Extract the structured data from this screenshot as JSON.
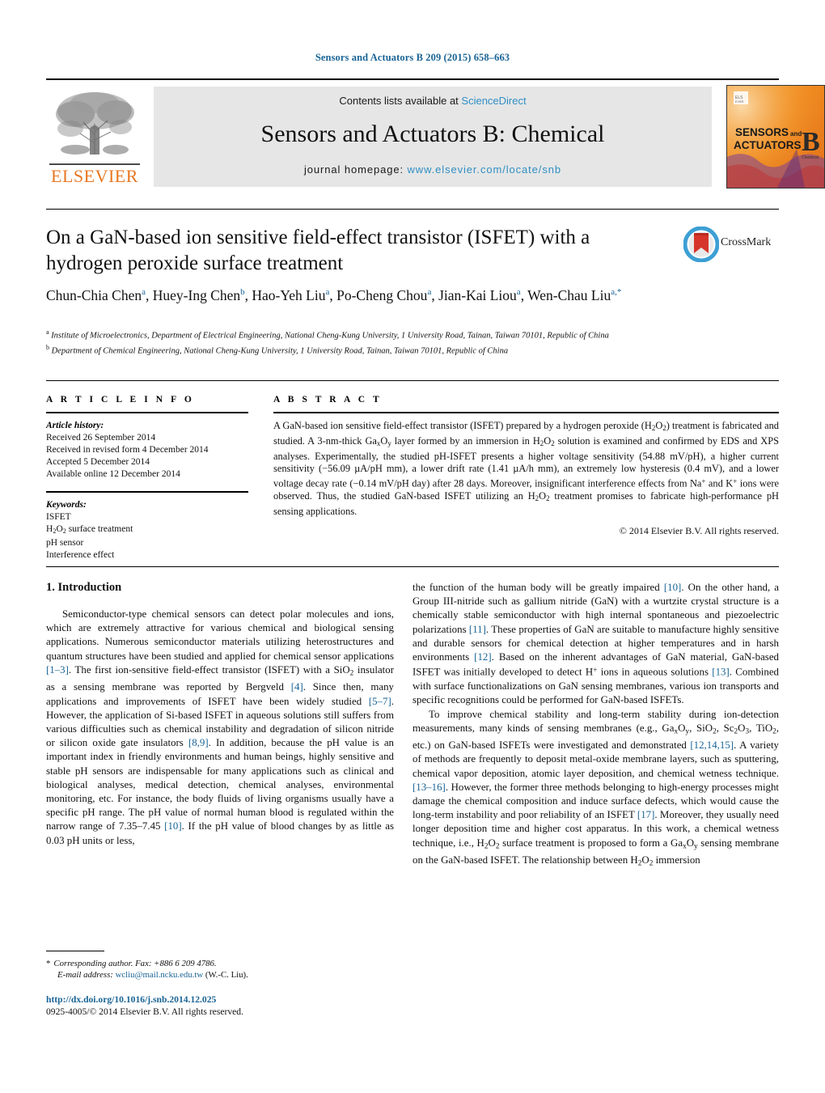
{
  "running_head": "Sensors and Actuators B 209 (2015) 658–663",
  "banner": {
    "contents_prefix": "Contents lists available at ",
    "sciencedirect": "ScienceDirect",
    "journal_title": "Sensors and Actuators B: Chemical",
    "homepage_prefix": "journal homepage: ",
    "homepage_url": "www.elsevier.com/locate/snb",
    "publisher": "ELSEVIER",
    "cover": {
      "line1": "SENSORS",
      "line1_small": "and",
      "line2": "ACTUATORS",
      "letter": "B",
      "letter_sub": "Chemical"
    }
  },
  "article": {
    "title": "On a GaN-based ion sensitive field-effect transistor (ISFET) with a hydrogen peroxide surface treatment",
    "authors_html": "Chun-Chia Chen<sup>a</sup>, Huey-Ing Chen<sup>b</sup>, Hao-Yeh Liu<sup>a</sup>, Po-Cheng Chou<sup>a</sup>, Jian-Kai Liou<sup>a</sup>, Wen-Chau Liu<sup>a,*</sup>",
    "affiliation_a": "Institute of Microelectronics, Department of Electrical Engineering, National Cheng-Kung University, 1 University Road, Tainan, Taiwan 70101, Republic of China",
    "affiliation_b": "Department of Chemical Engineering, National Cheng-Kung University, 1 University Road, Tainan, Taiwan 70101, Republic of China",
    "crossmark_label": "CrossMark"
  },
  "info": {
    "heading": "A R T I C L E   I N F O",
    "history_label": "Article history:",
    "history": [
      "Received 26 September 2014",
      "Received in revised form 4 December 2014",
      "Accepted 5 December 2014",
      "Available online 12 December 2014"
    ],
    "keywords_label": "Keywords:",
    "keywords_html": [
      "ISFET",
      "H<sub>2</sub>O<sub>2</sub> surface treatment",
      "pH sensor",
      "Interference effect"
    ]
  },
  "abstract": {
    "heading": "A B S T R A C T",
    "text_html": "A GaN-based ion sensitive field-effect transistor (ISFET) prepared by a hydrogen peroxide (H<sub>2</sub>O<sub>2</sub>) treatment is fabricated and studied. A 3-nm-thick Ga<sub>x</sub>O<sub>y</sub> layer formed by an immersion in H<sub>2</sub>O<sub>2</sub> solution is examined and confirmed by EDS and XPS analyses. Experimentally, the studied pH-ISFET presents a higher voltage sensitivity (54.88 mV/pH), a higher current sensitivity (−56.09 &#181;A/pH mm), a lower drift rate (1.41 &#181;A/h mm), an extremely low hysteresis (0.4 mV), and a lower voltage decay rate (−0.14 mV/pH day) after 28 days. Moreover, insignificant interference effects from Na<sup class=\"sm\">+</sup> and K<sup class=\"sm\">+</sup> ions were observed. Thus, the studied GaN-based ISFET utilizing an H<sub>2</sub>O<sub>2</sub> treatment promises to fabricate high-performance pH sensing applications.",
    "copyright": "© 2014 Elsevier B.V. All rights reserved."
  },
  "body": {
    "section_heading": "1.  Introduction",
    "left_paragraphs_html": [
      "Semiconductor-type chemical sensors can detect polar molecules and ions, which are extremely attractive for various chemical and biological sensing applications. Numerous semiconductor materials utilizing heterostructures and quantum structures have been studied and applied for chemical sensor applications <span class=\"ref\">[1–3]</span>. The first ion-sensitive field-effect transistor (ISFET) with a SiO<sub>2</sub> insulator as a sensing membrane was reported by Bergveld <span class=\"ref\">[4]</span>. Since then, many applications and improvements of ISFET have been widely studied <span class=\"ref\">[5–7]</span>. However, the application of Si-based ISFET in aqueous solutions still suffers from various difficulties such as chemical instability and degradation of silicon nitride or silicon oxide gate insulators <span class=\"ref\">[8,9]</span>. In addition, because the pH value is an important index in friendly environments and human beings, highly sensitive and stable pH sensors are indispensable for many applications such as clinical and biological analyses, medical detection, chemical analyses, environmental monitoring, etc. For instance, the body fluids of living organisms usually have a specific pH range. The pH value of normal human blood is regulated within the narrow range of 7.35–7.45 <span class=\"ref\">[10]</span>. If the pH value of blood changes by as little as 0.03 pH units or less,"
    ],
    "right_paragraphs_html": [
      "the function of the human body will be greatly impaired <span class=\"ref\">[10]</span>. On the other hand, a Group III-nitride such as gallium nitride (GaN) with a wurtzite crystal structure is a chemically stable semiconductor with high internal spontaneous and piezoelectric polarizations <span class=\"ref\">[11]</span>. These properties of GaN are suitable to manufacture highly sensitive and durable sensors for chemical detection at higher temperatures and in harsh environments <span class=\"ref\">[12]</span>. Based on the inherent advantages of GaN material, GaN-based ISFET was initially developed to detect H<sup class=\"sm\">+</sup> ions in aqueous solutions <span class=\"ref\">[13]</span>. Combined with surface functionalizations on GaN sensing membranes, various ion transports and specific recognitions could be performed for GaN-based ISFETs.",
      "To improve chemical stability and long-term stability during ion-detection measurements, many kinds of sensing membranes (e.g., Ga<sub>x</sub>O<sub>y</sub>, SiO<sub>2</sub>, Sc<sub>2</sub>O<sub>3</sub>, TiO<sub>2</sub>, etc.) on GaN-based ISFETs were investigated and demonstrated <span class=\"ref\">[12,14,15]</span>. A variety of methods are frequently to deposit metal-oxide membrane layers, such as sputtering, chemical vapor deposition, atomic layer deposition, and chemical wetness technique. <span class=\"ref\">[13–16]</span>. However, the former three methods belonging to high-energy processes might damage the chemical composition and induce surface defects, which would cause the long-term instability and poor reliability of an ISFET <span class=\"ref\">[17]</span>. Moreover, they usually need longer deposition time and higher cost apparatus. In this work, a chemical wetness technique, i.e., H<sub>2</sub>O<sub>2</sub> surface treatment is proposed to form a Ga<sub>x</sub>O<sub>y</sub> sensing membrane on the GaN-based ISFET. The relationship between H<sub>2</sub>O<sub>2</sub> immersion"
    ]
  },
  "footnote": {
    "corresponding_html": "<span style=\"font-style:italic\">Corresponding author. Fax: +886 6 209 4786.</span>",
    "email_label": "E-mail address:",
    "email": "wcliu@mail.ncku.edu.tw",
    "email_owner": "(W.-C. Liu)."
  },
  "footer": {
    "doi": "http://dx.doi.org/10.1016/j.snb.2014.12.025",
    "issn_html": "0925-4005/© 2014 Elsevier B.V. All rights reserved."
  },
  "colors": {
    "link": "#1a6496",
    "elsevier_orange": "#E87722",
    "banner_bg": "#e6e6e6"
  }
}
